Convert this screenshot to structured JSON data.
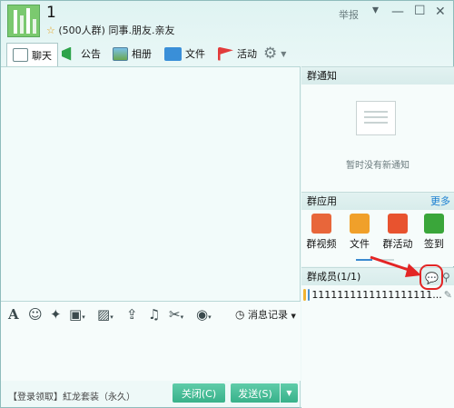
{
  "header": {
    "title": "1",
    "sub_count": "(500人群)",
    "sub_tags": "同事.朋友.亲友",
    "report": "举报"
  },
  "tabs": [
    {
      "label": "聊天"
    },
    {
      "label": "公告"
    },
    {
      "label": "相册"
    },
    {
      "label": "文件"
    },
    {
      "label": "活动"
    }
  ],
  "toolbar": {
    "message_record": "消息记录"
  },
  "bottom": {
    "promo": "【登录领取】紅龙套装（永久）",
    "close_label": "关闭(C)",
    "send_label": "发送(S)"
  },
  "panel": {
    "notice_title": "群通知",
    "notice_empty": "暂时没有新通知",
    "apps_title": "群应用",
    "apps_more": "更多",
    "apps": [
      {
        "label": "群视频",
        "color": "#e8663a"
      },
      {
        "label": "文件",
        "color": "#f0a02a"
      },
      {
        "label": "群活动",
        "color": "#e8532f"
      },
      {
        "label": "签到",
        "color": "#3aa63a"
      }
    ],
    "members_title": "群成员(1/1)",
    "member_name": "1111111111111111111..."
  },
  "colors": {
    "accent": "#38b18a",
    "more_link": "#1b7fd1",
    "highlight": "#e32525"
  }
}
